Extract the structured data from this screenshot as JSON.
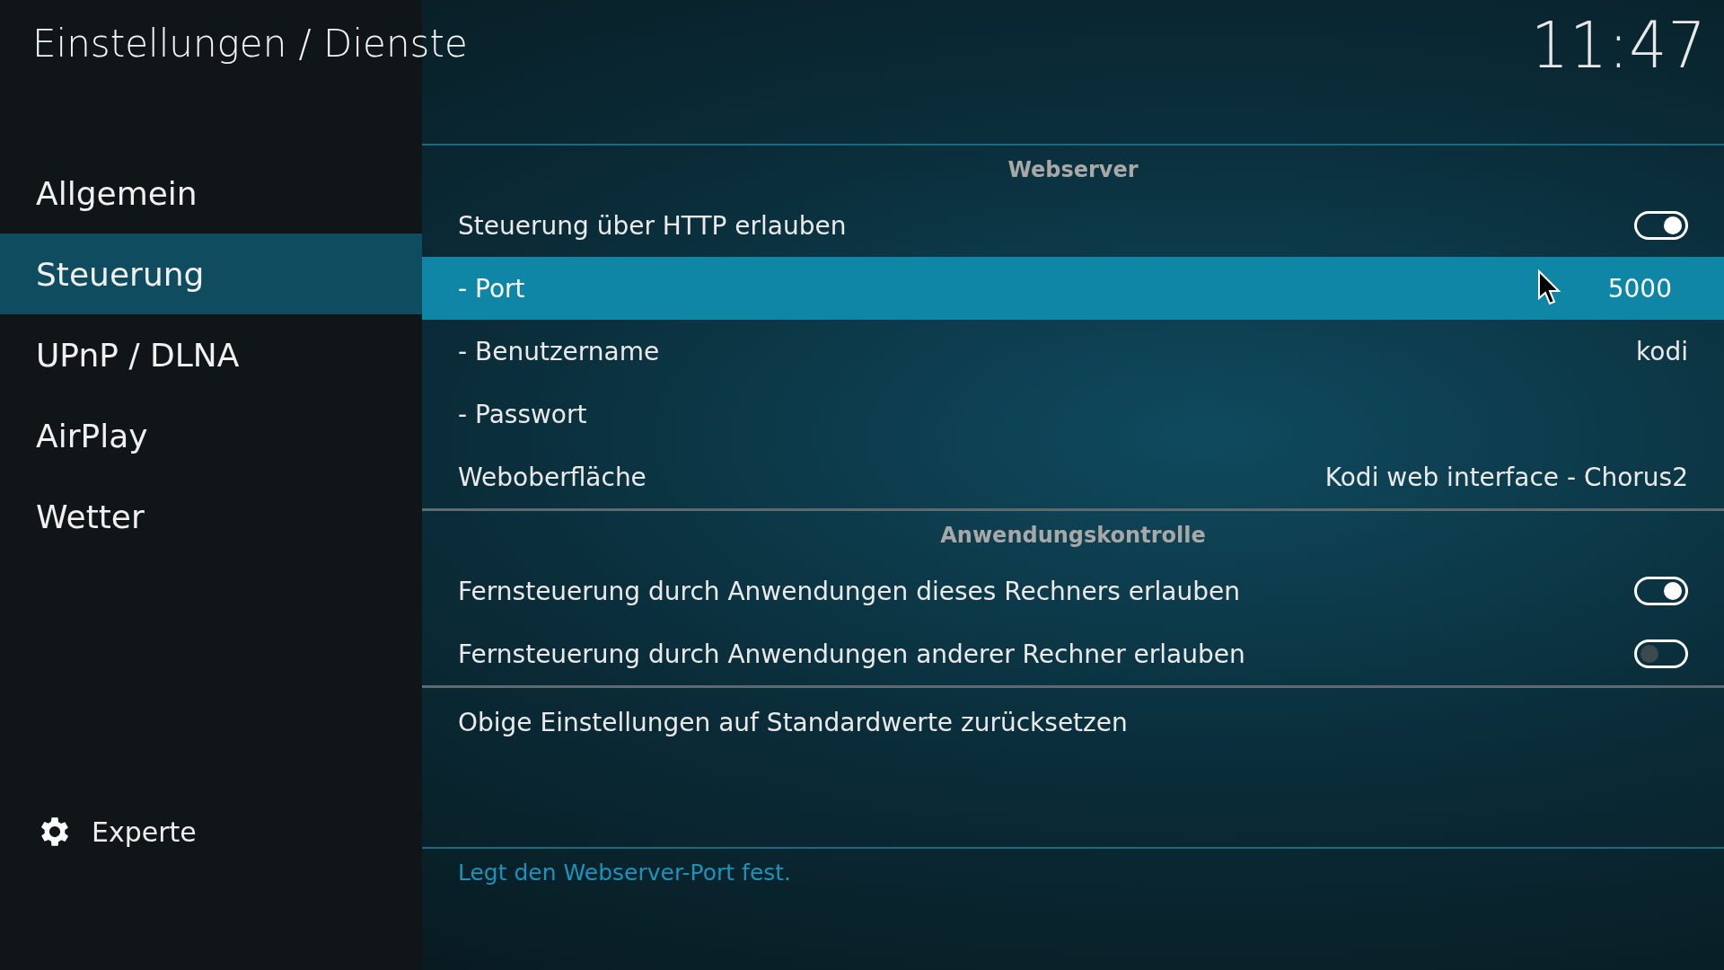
{
  "header": {
    "title": "Einstellungen / Dienste",
    "clock": "11:47"
  },
  "sidebar": {
    "items": [
      {
        "label": "Allgemein",
        "selected": false
      },
      {
        "label": "Steuerung",
        "selected": true
      },
      {
        "label": "UPnP / DLNA",
        "selected": false
      },
      {
        "label": "AirPlay",
        "selected": false
      },
      {
        "label": "Wetter",
        "selected": false
      }
    ],
    "level_button": {
      "label": "Experte"
    }
  },
  "sections": [
    {
      "title": "Webserver",
      "rows": [
        {
          "kind": "toggle",
          "label": "Steuerung über HTTP erlauben",
          "on": true,
          "selected": false
        },
        {
          "kind": "value",
          "label": "- Port",
          "value": "5000",
          "selected": true
        },
        {
          "kind": "value",
          "label": "- Benutzername",
          "value": "kodi",
          "selected": false
        },
        {
          "kind": "value",
          "label": "- Passwort",
          "selected": false
        },
        {
          "kind": "value",
          "label": "Weboberfläche",
          "value": "Kodi web interface - Chorus2",
          "selected": false
        }
      ]
    },
    {
      "title": "Anwendungskontrolle",
      "rows": [
        {
          "kind": "toggle",
          "label": "Fernsteuerung durch Anwendungen dieses Rechners erlauben",
          "on": true,
          "selected": false
        },
        {
          "kind": "toggle",
          "label": "Fernsteuerung durch Anwendungen anderer Rechner erlauben",
          "on": false,
          "selected": false
        }
      ]
    },
    {
      "rows": [
        {
          "kind": "action",
          "label": "Obige Einstellungen auf Standardwerte zurücksetzen",
          "selected": false
        }
      ]
    }
  ],
  "help_text": "Legt den Webserver-Port fest."
}
